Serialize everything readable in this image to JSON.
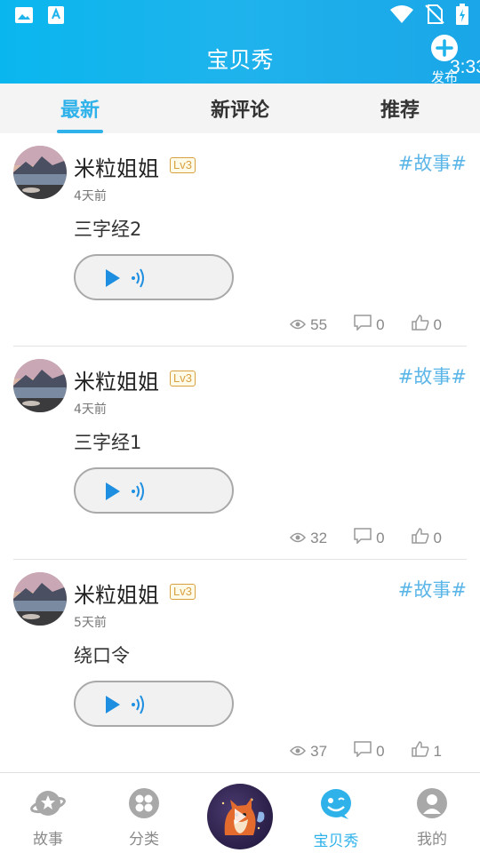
{
  "status_bar": {
    "time": "3:33"
  },
  "header": {
    "title": "宝贝秀",
    "publish_label": "发布"
  },
  "tabs": [
    {
      "label": "最新",
      "active": true
    },
    {
      "label": "新评论",
      "active": false
    },
    {
      "label": "推荐",
      "active": false
    }
  ],
  "posts": [
    {
      "user": "米粒姐姐",
      "level": "Lv3",
      "topic": "#故事#",
      "time": "4天前",
      "title": "三字经2",
      "views": "55",
      "comments": "0",
      "likes": "0"
    },
    {
      "user": "米粒姐姐",
      "level": "Lv3",
      "topic": "#故事#",
      "time": "4天前",
      "title": "三字经1",
      "views": "32",
      "comments": "0",
      "likes": "0"
    },
    {
      "user": "米粒姐姐",
      "level": "Lv3",
      "topic": "#故事#",
      "time": "5天前",
      "title": "绕口令",
      "views": "37",
      "comments": "0",
      "likes": "1"
    }
  ],
  "bottom_nav": [
    {
      "label": "故事",
      "icon": "planet-icon",
      "active": false
    },
    {
      "label": "分类",
      "icon": "category-icon",
      "active": false
    },
    {
      "label": "",
      "icon": "player-cover",
      "active": false
    },
    {
      "label": "宝贝秀",
      "icon": "smiley-icon",
      "active": true
    },
    {
      "label": "我的",
      "icon": "profile-icon",
      "active": false
    }
  ],
  "colors": {
    "accent": "#2fb2ea",
    "topbar": "#1fb3ec",
    "level_badge": "#d9a040",
    "topic": "#5bb6e8"
  }
}
